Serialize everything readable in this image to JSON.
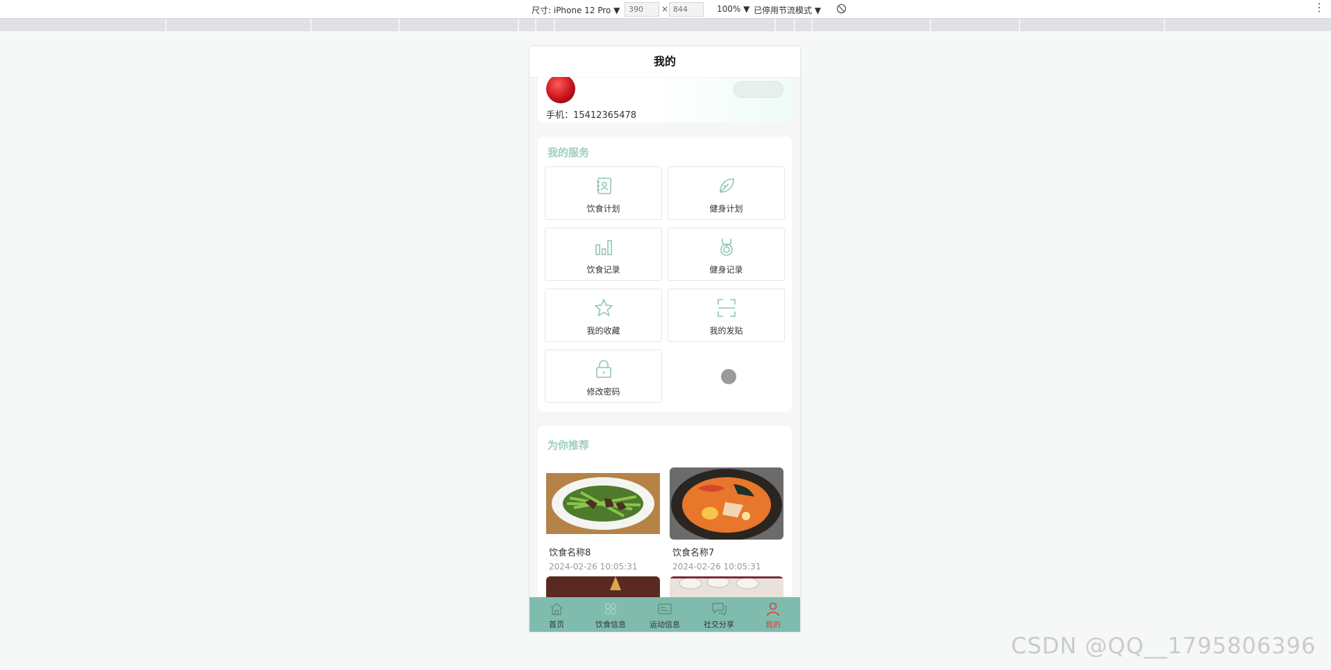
{
  "devtools": {
    "device_label": "尺寸: iPhone 12 Pro ▼",
    "width": "390",
    "times": "×",
    "height": "844",
    "zoom": "100% ▼",
    "throttle": "已停用节流模式 ▼",
    "more": "⋮"
  },
  "page": {
    "title": "我的"
  },
  "profile": {
    "phone": "手机：15412365478"
  },
  "services": {
    "title": "我的服务",
    "items": [
      {
        "label": "饮食计划",
        "icon": "contact-book-icon"
      },
      {
        "label": "健身计划",
        "icon": "leaf-icon"
      },
      {
        "label": "饮食记录",
        "icon": "bar-chart-icon"
      },
      {
        "label": "健身记录",
        "icon": "medal-icon"
      },
      {
        "label": "我的收藏",
        "icon": "star-icon"
      },
      {
        "label": "我的发贴",
        "icon": "scan-icon"
      },
      {
        "label": "修改密码",
        "icon": "lock-icon"
      }
    ]
  },
  "recommend": {
    "title": "为你推荐",
    "items": [
      {
        "name": "饮食名称8",
        "time": "2024-02-26 10:05:31"
      },
      {
        "name": "饮食名称7",
        "time": "2024-02-26 10:05:31"
      }
    ]
  },
  "tabbar": {
    "items": [
      {
        "label": "首页",
        "icon": "home-icon"
      },
      {
        "label": "饮食信息",
        "icon": "food-icon"
      },
      {
        "label": "运动信息",
        "icon": "sport-icon"
      },
      {
        "label": "社交分享",
        "icon": "chat-icon"
      },
      {
        "label": "我的",
        "icon": "user-icon"
      }
    ],
    "active_index": 4
  },
  "colors": {
    "accent": "#7fbcae",
    "section_title": "#9ecdc2",
    "icon": "#8fc4b8",
    "active_tab": "#e33a3a"
  },
  "watermark": "CSDN @QQ__1795806396"
}
